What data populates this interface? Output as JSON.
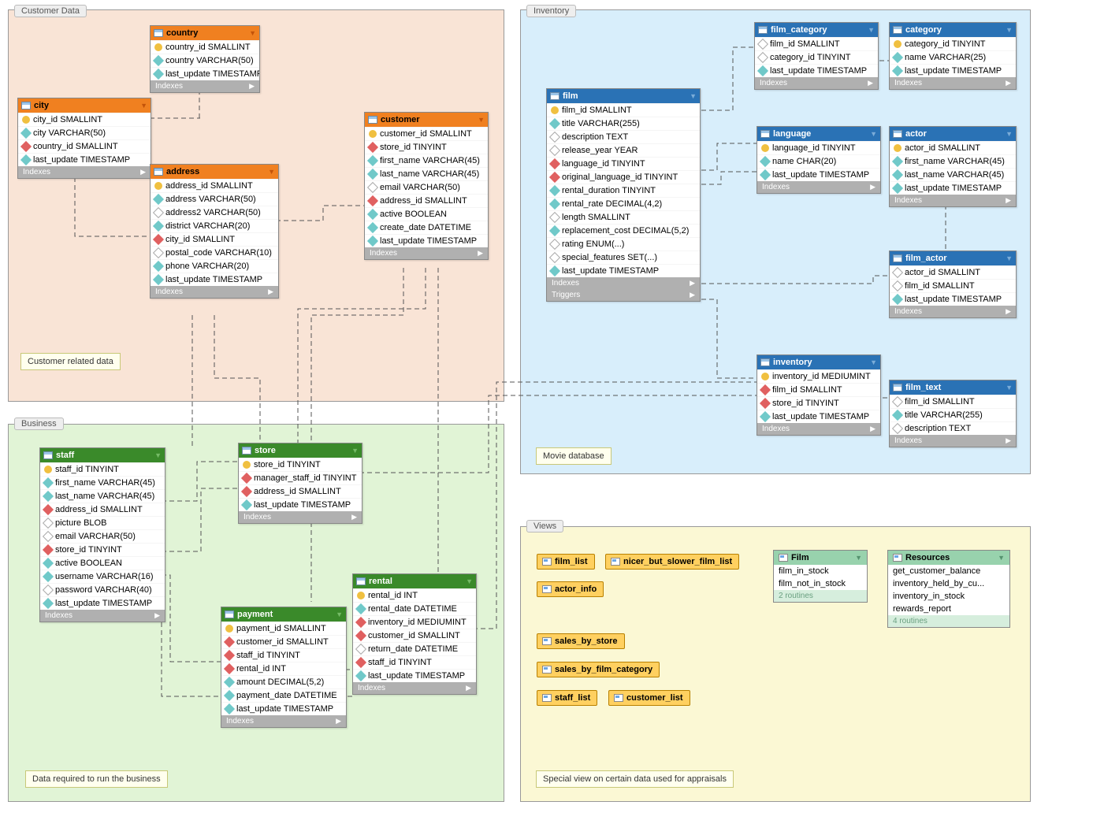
{
  "regions": {
    "customer": {
      "label": "Customer Data",
      "note": "Customer related data"
    },
    "inventory": {
      "label": "Inventory",
      "note": "Movie database"
    },
    "business": {
      "label": "Business",
      "note": "Data required to run the business"
    },
    "views": {
      "label": "Views",
      "note": "Special view on certain data used for appraisals"
    }
  },
  "section_labels": {
    "indexes": "Indexes",
    "triggers": "Triggers"
  },
  "tables": {
    "country": {
      "title": "country",
      "cols": [
        {
          "icon": "pk",
          "name": "country_id SMALLINT"
        },
        {
          "icon": "idx",
          "name": "country VARCHAR(50)"
        },
        {
          "icon": "idx",
          "name": "last_update TIMESTAMP"
        }
      ],
      "extra": [
        "indexes"
      ]
    },
    "city": {
      "title": "city",
      "cols": [
        {
          "icon": "pk",
          "name": "city_id SMALLINT"
        },
        {
          "icon": "idx",
          "name": "city VARCHAR(50)"
        },
        {
          "icon": "fk",
          "name": "country_id SMALLINT"
        },
        {
          "icon": "idx",
          "name": "last_update TIMESTAMP"
        }
      ],
      "extra": [
        "indexes"
      ]
    },
    "address": {
      "title": "address",
      "cols": [
        {
          "icon": "pk",
          "name": "address_id SMALLINT"
        },
        {
          "icon": "idx",
          "name": "address VARCHAR(50)"
        },
        {
          "icon": "plain",
          "name": "address2 VARCHAR(50)"
        },
        {
          "icon": "idx",
          "name": "district VARCHAR(20)"
        },
        {
          "icon": "fk",
          "name": "city_id SMALLINT"
        },
        {
          "icon": "plain",
          "name": "postal_code VARCHAR(10)"
        },
        {
          "icon": "idx",
          "name": "phone VARCHAR(20)"
        },
        {
          "icon": "idx",
          "name": "last_update TIMESTAMP"
        }
      ],
      "extra": [
        "indexes"
      ]
    },
    "customer": {
      "title": "customer",
      "cols": [
        {
          "icon": "pk",
          "name": "customer_id SMALLINT"
        },
        {
          "icon": "fk",
          "name": "store_id TINYINT"
        },
        {
          "icon": "idx",
          "name": "first_name VARCHAR(45)"
        },
        {
          "icon": "idx",
          "name": "last_name VARCHAR(45)"
        },
        {
          "icon": "plain",
          "name": "email VARCHAR(50)"
        },
        {
          "icon": "fk",
          "name": "address_id SMALLINT"
        },
        {
          "icon": "idx",
          "name": "active BOOLEAN"
        },
        {
          "icon": "idx",
          "name": "create_date DATETIME"
        },
        {
          "icon": "idx",
          "name": "last_update TIMESTAMP"
        }
      ],
      "extra": [
        "indexes"
      ]
    },
    "staff": {
      "title": "staff",
      "cols": [
        {
          "icon": "pk",
          "name": "staff_id TINYINT"
        },
        {
          "icon": "idx",
          "name": "first_name VARCHAR(45)"
        },
        {
          "icon": "idx",
          "name": "last_name VARCHAR(45)"
        },
        {
          "icon": "fk",
          "name": "address_id SMALLINT"
        },
        {
          "icon": "plain",
          "name": "picture BLOB"
        },
        {
          "icon": "plain",
          "name": "email VARCHAR(50)"
        },
        {
          "icon": "fk",
          "name": "store_id TINYINT"
        },
        {
          "icon": "idx",
          "name": "active BOOLEAN"
        },
        {
          "icon": "idx",
          "name": "username VARCHAR(16)"
        },
        {
          "icon": "plain",
          "name": "password VARCHAR(40)"
        },
        {
          "icon": "idx",
          "name": "last_update TIMESTAMP"
        }
      ],
      "extra": [
        "indexes"
      ]
    },
    "store": {
      "title": "store",
      "cols": [
        {
          "icon": "pk",
          "name": "store_id TINYINT"
        },
        {
          "icon": "fk",
          "name": "manager_staff_id TINYINT"
        },
        {
          "icon": "fk",
          "name": "address_id SMALLINT"
        },
        {
          "icon": "idx",
          "name": "last_update TIMESTAMP"
        }
      ],
      "extra": [
        "indexes"
      ]
    },
    "payment": {
      "title": "payment",
      "cols": [
        {
          "icon": "pk",
          "name": "payment_id SMALLINT"
        },
        {
          "icon": "fk",
          "name": "customer_id SMALLINT"
        },
        {
          "icon": "fk",
          "name": "staff_id TINYINT"
        },
        {
          "icon": "fk",
          "name": "rental_id INT"
        },
        {
          "icon": "idx",
          "name": "amount DECIMAL(5,2)"
        },
        {
          "icon": "idx",
          "name": "payment_date DATETIME"
        },
        {
          "icon": "idx",
          "name": "last_update TIMESTAMP"
        }
      ],
      "extra": [
        "indexes"
      ]
    },
    "rental": {
      "title": "rental",
      "cols": [
        {
          "icon": "pk",
          "name": "rental_id INT"
        },
        {
          "icon": "idx",
          "name": "rental_date DATETIME"
        },
        {
          "icon": "fk",
          "name": "inventory_id MEDIUMINT"
        },
        {
          "icon": "fk",
          "name": "customer_id SMALLINT"
        },
        {
          "icon": "plain",
          "name": "return_date DATETIME"
        },
        {
          "icon": "fk",
          "name": "staff_id TINYINT"
        },
        {
          "icon": "idx",
          "name": "last_update TIMESTAMP"
        }
      ],
      "extra": [
        "indexes"
      ]
    },
    "film": {
      "title": "film",
      "cols": [
        {
          "icon": "pk",
          "name": "film_id SMALLINT"
        },
        {
          "icon": "idx",
          "name": "title VARCHAR(255)"
        },
        {
          "icon": "plain",
          "name": "description TEXT"
        },
        {
          "icon": "plain",
          "name": "release_year YEAR"
        },
        {
          "icon": "fk",
          "name": "language_id TINYINT"
        },
        {
          "icon": "fk",
          "name": "original_language_id TINYINT"
        },
        {
          "icon": "idx",
          "name": "rental_duration TINYINT"
        },
        {
          "icon": "idx",
          "name": "rental_rate DECIMAL(4,2)"
        },
        {
          "icon": "plain",
          "name": "length SMALLINT"
        },
        {
          "icon": "idx",
          "name": "replacement_cost DECIMAL(5,2)"
        },
        {
          "icon": "plain",
          "name": "rating ENUM(...)"
        },
        {
          "icon": "plain",
          "name": "special_features SET(...)"
        },
        {
          "icon": "idx",
          "name": "last_update TIMESTAMP"
        }
      ],
      "extra": [
        "indexes",
        "triggers"
      ]
    },
    "film_category": {
      "title": "film_category",
      "cols": [
        {
          "icon": "plain",
          "name": "film_id SMALLINT"
        },
        {
          "icon": "plain",
          "name": "category_id TINYINT"
        },
        {
          "icon": "idx",
          "name": "last_update TIMESTAMP"
        }
      ],
      "extra": [
        "indexes"
      ]
    },
    "category": {
      "title": "category",
      "cols": [
        {
          "icon": "pk",
          "name": "category_id TINYINT"
        },
        {
          "icon": "idx",
          "name": "name VARCHAR(25)"
        },
        {
          "icon": "idx",
          "name": "last_update TIMESTAMP"
        }
      ],
      "extra": [
        "indexes"
      ]
    },
    "language": {
      "title": "language",
      "cols": [
        {
          "icon": "pk",
          "name": "language_id TINYINT"
        },
        {
          "icon": "idx",
          "name": "name CHAR(20)"
        },
        {
          "icon": "idx",
          "name": "last_update TIMESTAMP"
        }
      ],
      "extra": [
        "indexes"
      ]
    },
    "actor": {
      "title": "actor",
      "cols": [
        {
          "icon": "pk",
          "name": "actor_id SMALLINT"
        },
        {
          "icon": "idx",
          "name": "first_name VARCHAR(45)"
        },
        {
          "icon": "idx",
          "name": "last_name VARCHAR(45)"
        },
        {
          "icon": "idx",
          "name": "last_update TIMESTAMP"
        }
      ],
      "extra": [
        "indexes"
      ]
    },
    "film_actor": {
      "title": "film_actor",
      "cols": [
        {
          "icon": "plain",
          "name": "actor_id SMALLINT"
        },
        {
          "icon": "plain",
          "name": "film_id SMALLINT"
        },
        {
          "icon": "idx",
          "name": "last_update TIMESTAMP"
        }
      ],
      "extra": [
        "indexes"
      ]
    },
    "inventory": {
      "title": "inventory",
      "cols": [
        {
          "icon": "pk",
          "name": "inventory_id MEDIUMINT"
        },
        {
          "icon": "fk",
          "name": "film_id SMALLINT"
        },
        {
          "icon": "fk",
          "name": "store_id TINYINT"
        },
        {
          "icon": "idx",
          "name": "last_update TIMESTAMP"
        }
      ],
      "extra": [
        "indexes"
      ]
    },
    "film_text": {
      "title": "film_text",
      "cols": [
        {
          "icon": "plain",
          "name": "film_id SMALLINT"
        },
        {
          "icon": "idx",
          "name": "title VARCHAR(255)"
        },
        {
          "icon": "plain",
          "name": "description TEXT"
        }
      ],
      "extra": [
        "indexes"
      ]
    }
  },
  "views": {
    "chips": [
      {
        "label": "film_list"
      },
      {
        "label": "nicer_but_slower_film_list"
      },
      {
        "label": "actor_info"
      },
      {
        "label": "sales_by_store"
      },
      {
        "label": "sales_by_film_category"
      },
      {
        "label": "staff_list"
      },
      {
        "label": "customer_list"
      }
    ],
    "routine_groups": [
      {
        "title": "Film",
        "items": [
          "film_in_stock",
          "film_not_in_stock"
        ],
        "foot": "2 routines"
      },
      {
        "title": "Resources",
        "items": [
          "get_customer_balance",
          "inventory_held_by_cu...",
          "inventory_in_stock",
          "rewards_report"
        ],
        "foot": "4 routines"
      }
    ]
  }
}
